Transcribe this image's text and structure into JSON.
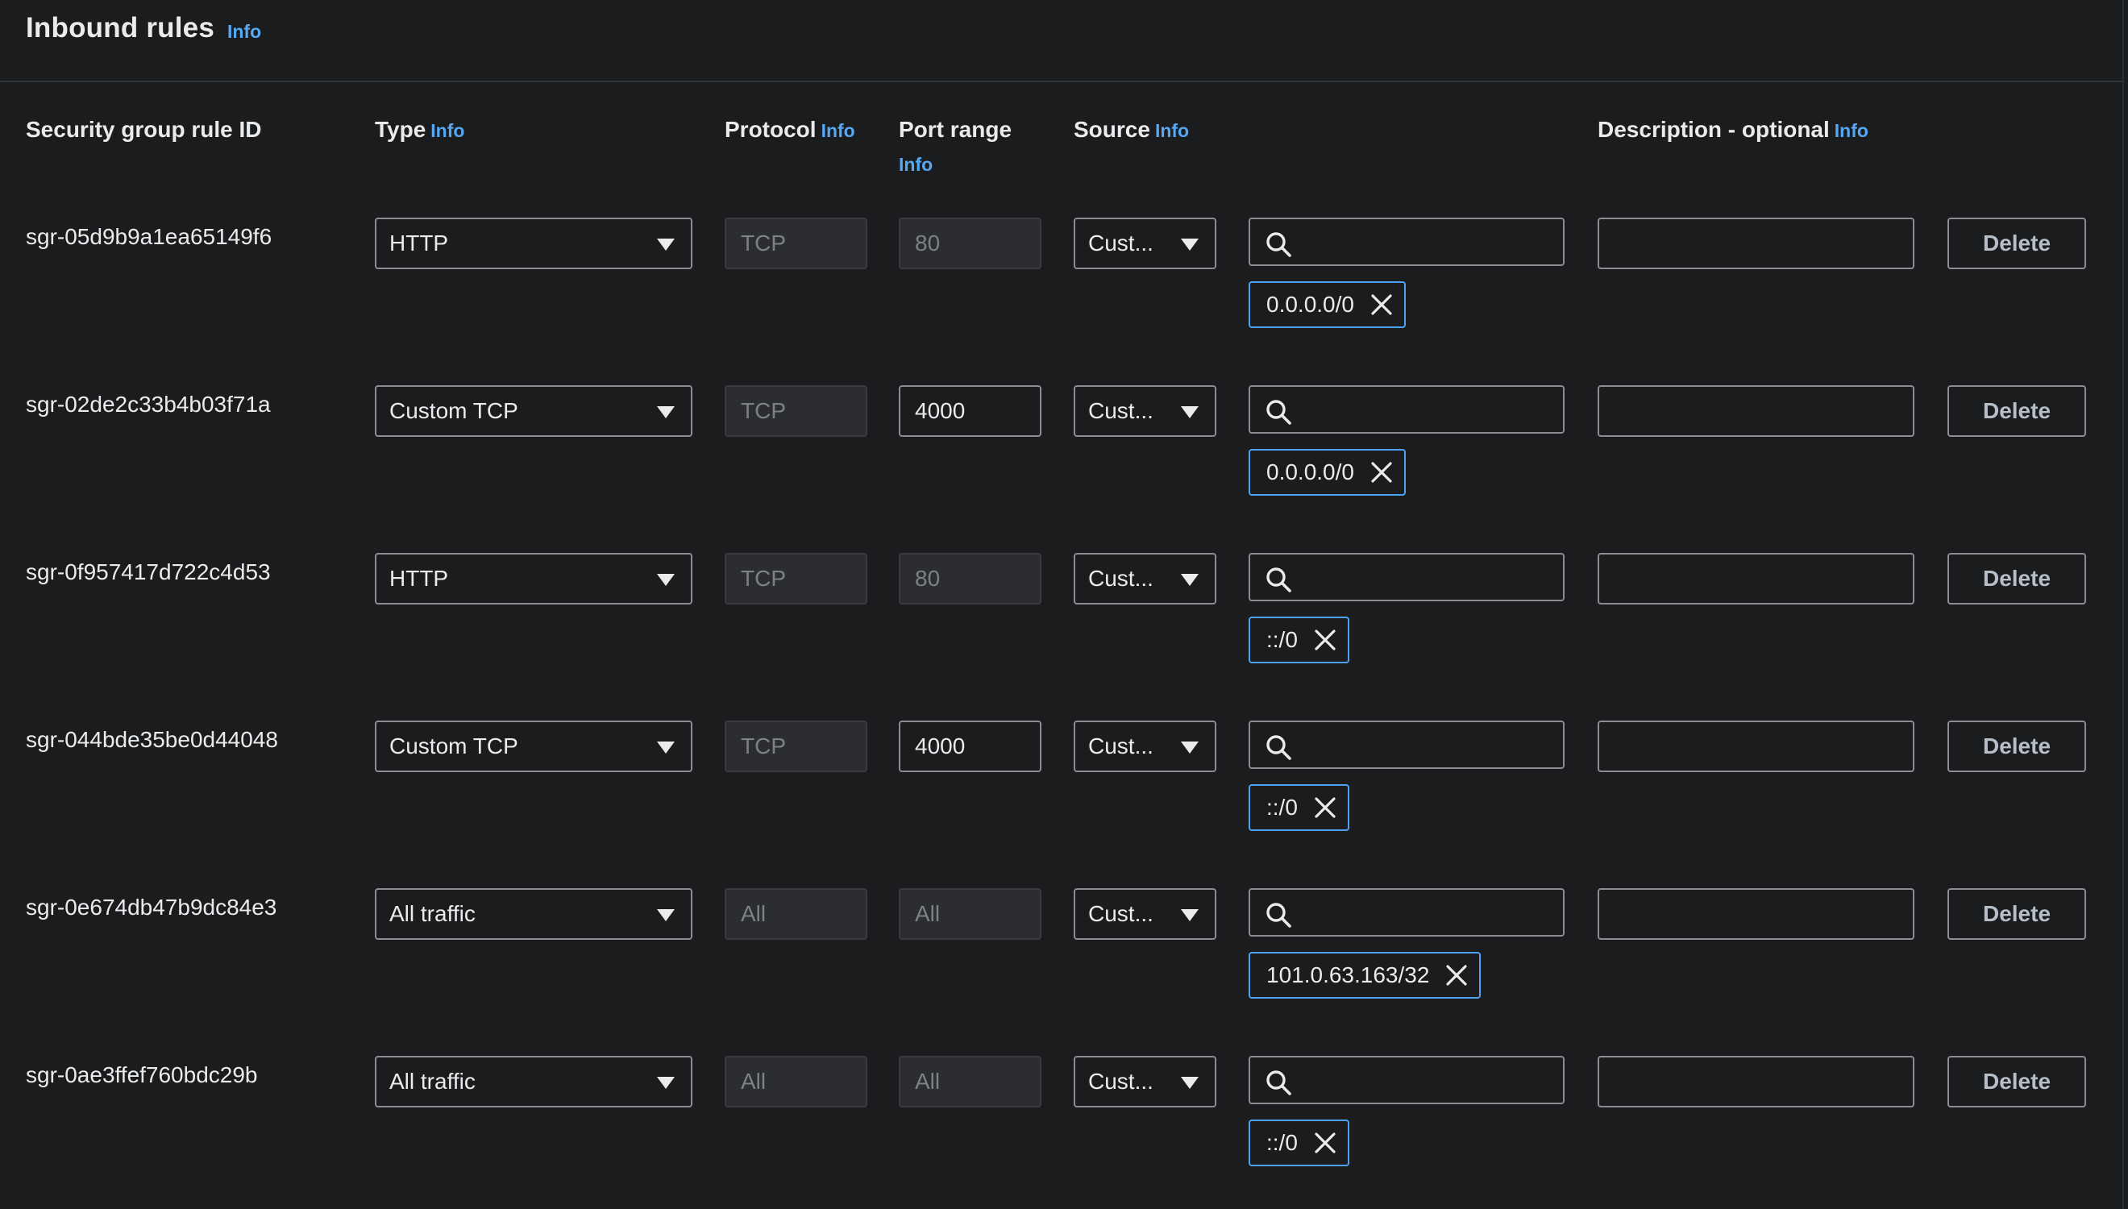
{
  "section": {
    "title": "Inbound rules",
    "info_label": "Info"
  },
  "columns": {
    "rule_id": "Security group rule ID",
    "type": "Type",
    "protocol": "Protocol",
    "port_range": "Port range",
    "source": "Source",
    "description": "Description - optional",
    "info": "Info"
  },
  "rows": [
    {
      "id": "sgr-05d9b9a1ea65149f6",
      "type": "HTTP",
      "protocol": "TCP",
      "port": "80",
      "port_editable": false,
      "source_type": "Cust...",
      "source_value": "0.0.0.0/0",
      "description": "",
      "delete": "Delete"
    },
    {
      "id": "sgr-02de2c33b4b03f71a",
      "type": "Custom TCP",
      "protocol": "TCP",
      "port": "4000",
      "port_editable": true,
      "source_type": "Cust...",
      "source_value": "0.0.0.0/0",
      "description": "",
      "delete": "Delete"
    },
    {
      "id": "sgr-0f957417d722c4d53",
      "type": "HTTP",
      "protocol": "TCP",
      "port": "80",
      "port_editable": false,
      "source_type": "Cust...",
      "source_value": "::/0",
      "description": "",
      "delete": "Delete"
    },
    {
      "id": "sgr-044bde35be0d44048",
      "type": "Custom TCP",
      "protocol": "TCP",
      "port": "4000",
      "port_editable": true,
      "source_type": "Cust...",
      "source_value": "::/0",
      "description": "",
      "delete": "Delete"
    },
    {
      "id": "sgr-0e674db47b9dc84e3",
      "type": "All traffic",
      "protocol": "All",
      "port": "All",
      "port_editable": false,
      "source_type": "Cust...",
      "source_value": "101.0.63.163/32",
      "description": "",
      "delete": "Delete"
    },
    {
      "id": "sgr-0ae3ffef760bdc29b",
      "type": "All traffic",
      "protocol": "All",
      "port": "All",
      "port_editable": false,
      "source_type": "Cust...",
      "source_value": "::/0",
      "description": "",
      "delete": "Delete"
    }
  ],
  "icons": {
    "search": "search-icon",
    "remove": "close-icon",
    "dropdown": "caret-down-icon"
  },
  "colors": {
    "background": "#1b1c1e",
    "info_link": "#57a8f2",
    "token_border": "#4ea3f0",
    "input_border": "#8c8c94",
    "disabled_bg": "#2b2d31"
  }
}
